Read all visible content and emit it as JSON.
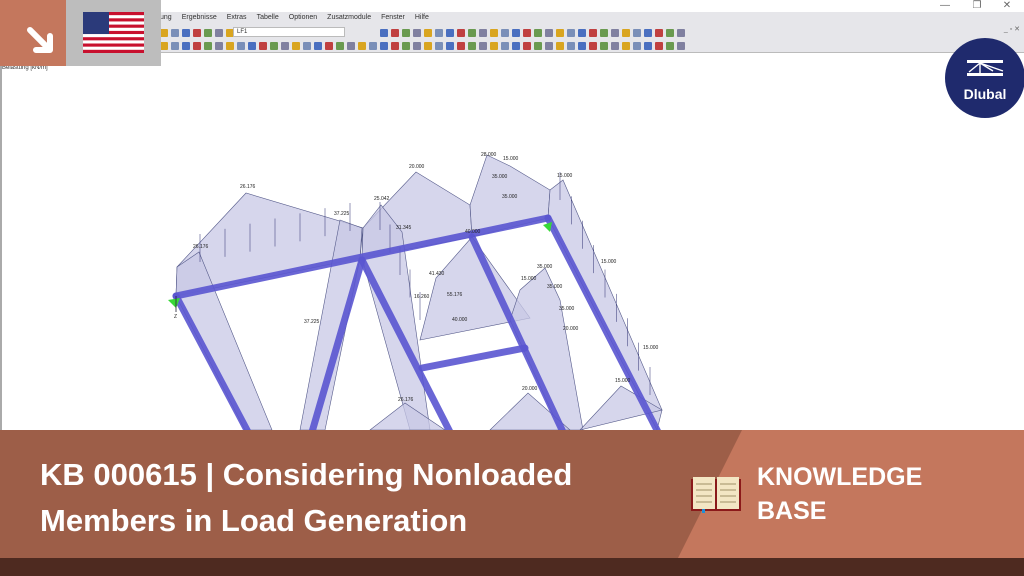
{
  "window": {
    "minimize": "—",
    "restore": "❐",
    "close": "✕",
    "mdi_controls": "_ ▫ ✕"
  },
  "menu": [
    "ung",
    "Ergebnisse",
    "Extras",
    "Tabelle",
    "Optionen",
    "Zusatzmodule",
    "Fenster",
    "Hilfe"
  ],
  "toolbar": {
    "load_case": "LF1"
  },
  "view": {
    "load_label": "Belastung [kN/m]",
    "axis_label": "Z"
  },
  "load_values": [
    "26.176",
    "26.176",
    "37.225",
    "25.042",
    "20.000",
    "28.000",
    "15.000",
    "35.000",
    "35.000",
    "15.000",
    "31.345",
    "40.000",
    "15.000",
    "41.430",
    "35.000",
    "15.000",
    "16.260",
    "55.176",
    "40.000",
    "35.000",
    "35.000",
    "20.000",
    "37.225",
    "15.000",
    "15.000",
    "20.000",
    "26.176"
  ],
  "colors": {
    "accent": "#c4775d",
    "accent_dark": "#9d5e48",
    "footer": "#4e2a20",
    "beam": "#5a55d0",
    "load_fill": "#c8c8e6",
    "logo": "#1f2a6d"
  },
  "logo": {
    "text": "Dlubal"
  },
  "banner": {
    "title": "KB 000615 | Considering Nonloaded Members in Load Generation",
    "category_line1": "KNOWLEDGE",
    "category_line2": "BASE"
  },
  "icons": {
    "corner": "arrow-down-right-icon",
    "flag": "us-flag-icon",
    "category": "open-book-icon"
  }
}
